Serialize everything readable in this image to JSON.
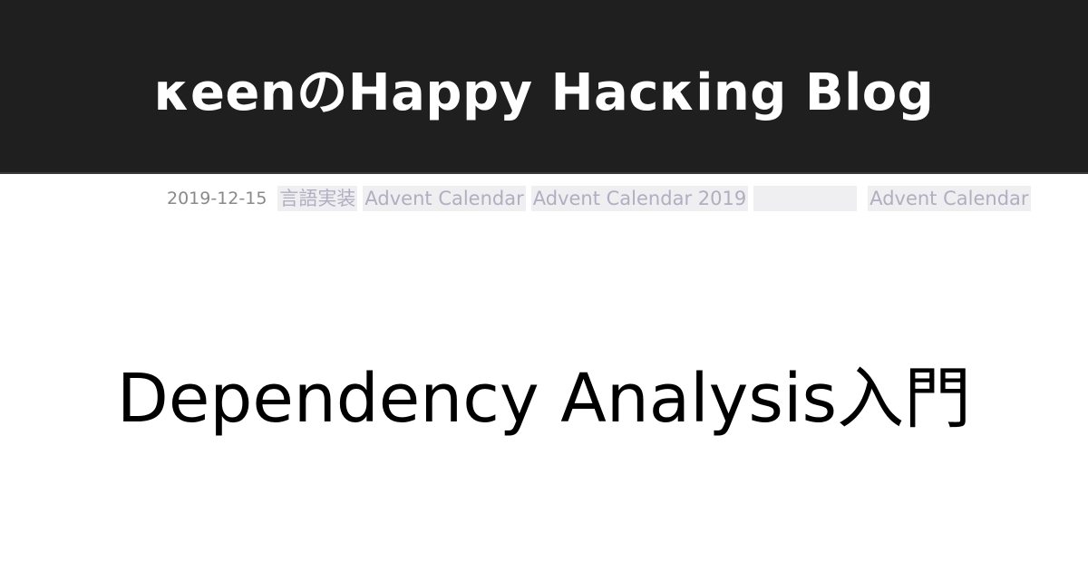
{
  "header": {
    "site_title": "κeenのHappy Hacκing Blog"
  },
  "post": {
    "date": "2019-12-15",
    "tags": [
      "言語実装",
      "Advent Calendar",
      "Advent Calendar 2019",
      "",
      "Advent Calendar"
    ],
    "title": "Dependency Analysis入門"
  }
}
